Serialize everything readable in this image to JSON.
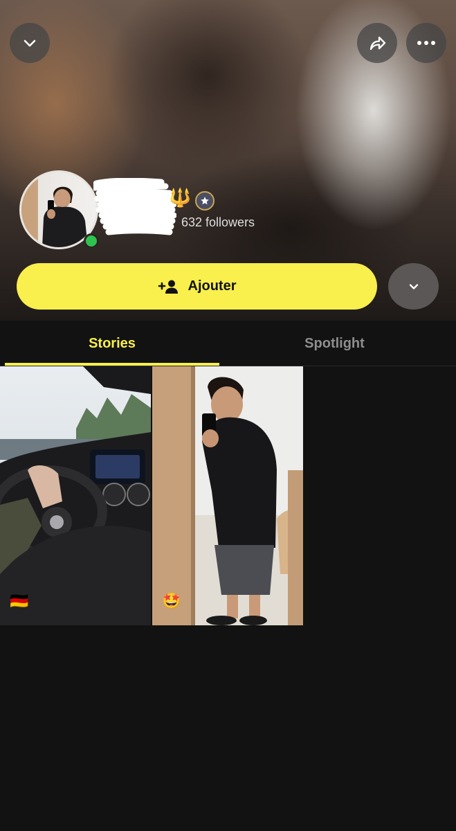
{
  "profile": {
    "followers": "632 followers",
    "trident": "🔱",
    "online": true
  },
  "actions": {
    "add_label": "Ajouter"
  },
  "tabs": [
    {
      "label": "Stories",
      "active": true
    },
    {
      "label": "Spotlight",
      "active": false
    }
  ],
  "stories": [
    {
      "emoji": "🇩🇪"
    },
    {
      "emoji": "🤩"
    }
  ],
  "icons": {
    "collapse": "chevron-down-icon",
    "share": "share-icon",
    "more": "more-icon",
    "add_friend": "add-friend-icon",
    "expand": "chevron-down-icon",
    "verified": "star-icon"
  },
  "colors": {
    "accent": "#f9ef4d",
    "online": "#2fc24f",
    "background": "#121212"
  }
}
